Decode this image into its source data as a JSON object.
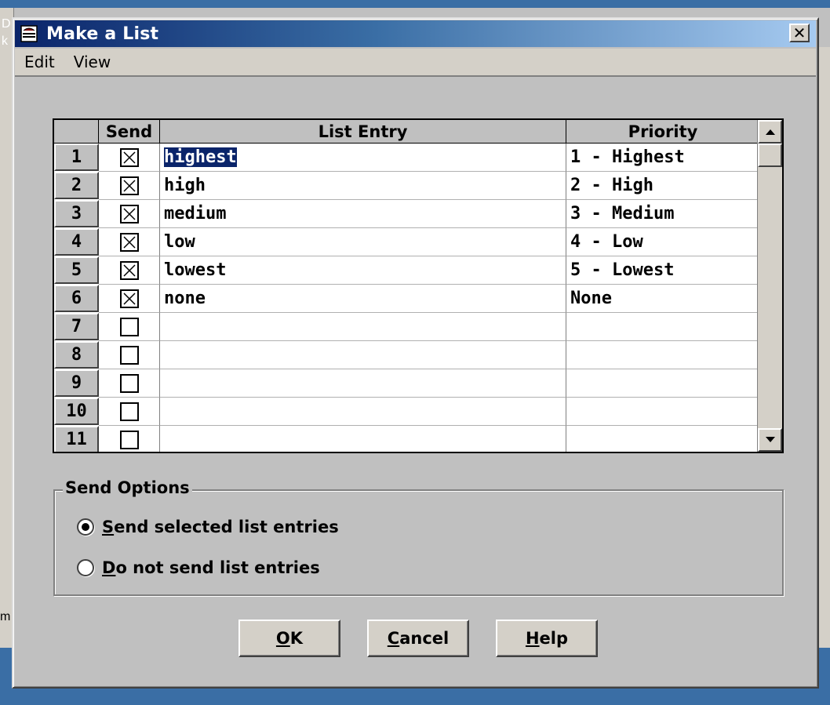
{
  "window": {
    "title": "Make a List",
    "close_label": "✕"
  },
  "menu": {
    "items": [
      "Edit",
      "View"
    ]
  },
  "grid": {
    "columns": [
      "Send",
      "List Entry",
      "Priority"
    ],
    "rows": [
      {
        "num": "1",
        "send": true,
        "entry": "highest",
        "priority": "1 - Highest",
        "selected": true
      },
      {
        "num": "2",
        "send": true,
        "entry": "high",
        "priority": "2 - High"
      },
      {
        "num": "3",
        "send": true,
        "entry": "medium",
        "priority": "3 - Medium"
      },
      {
        "num": "4",
        "send": true,
        "entry": "low",
        "priority": "4 - Low"
      },
      {
        "num": "5",
        "send": true,
        "entry": "lowest",
        "priority": "5 - Lowest"
      },
      {
        "num": "6",
        "send": true,
        "entry": "none",
        "priority": "None"
      },
      {
        "num": "7",
        "send": false,
        "entry": "",
        "priority": ""
      },
      {
        "num": "8",
        "send": false,
        "entry": "",
        "priority": ""
      },
      {
        "num": "9",
        "send": false,
        "entry": "",
        "priority": ""
      },
      {
        "num": "10",
        "send": false,
        "entry": "",
        "priority": ""
      },
      {
        "num": "11",
        "send": false,
        "entry": "",
        "priority": ""
      }
    ]
  },
  "send_options": {
    "label": "Send Options",
    "options": [
      {
        "accel": "S",
        "rest": "end selected list entries",
        "checked": true
      },
      {
        "accel": "D",
        "rest": "o not send list entries",
        "checked": false
      }
    ]
  },
  "buttons": {
    "ok": {
      "accel": "O",
      "rest": "K"
    },
    "cancel": {
      "accel": "C",
      "rest": "ancel"
    },
    "help": {
      "accel": "H",
      "rest": "elp"
    }
  },
  "background": {
    "fragments": [
      "D",
      "k",
      "m"
    ]
  },
  "colors": {
    "title_start": "#0a246a",
    "title_end": "#a6caf0",
    "selection": "#0a246a",
    "dialog_face": "#c0c0c0"
  }
}
